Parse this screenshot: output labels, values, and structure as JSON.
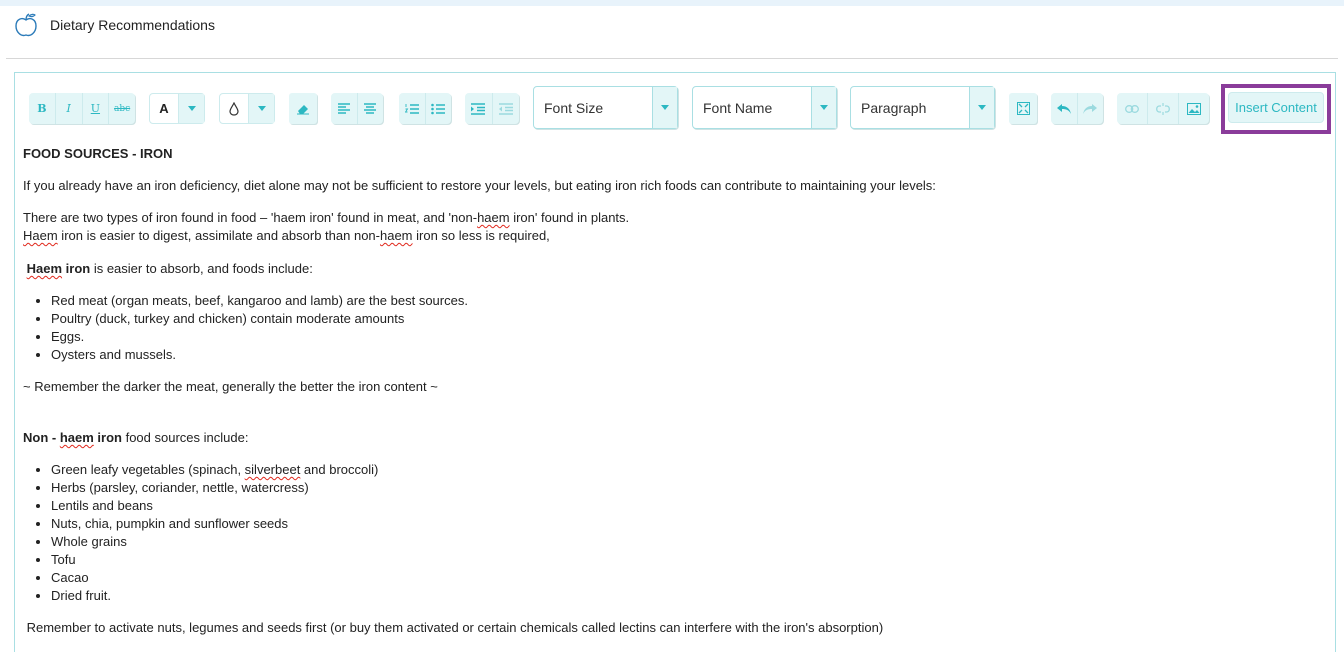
{
  "header": {
    "title": "Dietary Recommendations",
    "icon": "apple-icon"
  },
  "toolbar": {
    "bold_label": "B",
    "italic_label": "I",
    "underline_label": "U",
    "strikethrough_label": "abc",
    "font_color_label": "A",
    "font_size": {
      "value": "Font Size"
    },
    "font_name": {
      "value": "Font Name"
    },
    "format_block": {
      "value": "Paragraph"
    },
    "insert_content_label": "Insert Content",
    "accent_color": "#2cb8c2",
    "highlight_frame_color": "#8a3c9a"
  },
  "content": {
    "heading": "FOOD SOURCES  - IRON",
    "intro": "If you already have an iron deficiency, diet alone may not be sufficient to restore your levels, but eating iron rich foods can contribute to maintaining your levels:",
    "types_line_pre": "There are two types of iron found in food – 'haem iron' found in meat, and 'non-",
    "types_line_haem": "haem",
    "types_line_post": " iron' found in plants.",
    "digest_haem1": "Haem",
    "digest_mid": " iron is easier to digest, assimilate and absorb than non-",
    "digest_haem2": "haem",
    "digest_post": " iron so less is required,",
    "haem_heading_pre": " ",
    "haem_heading_bold1": "Haem",
    "haem_heading_bold2": " iron",
    "haem_heading_rest": " is easier to absorb, and foods include:",
    "haem_items": [
      "Red meat (organ meats, beef, kangaroo and lamb) are the best sources.",
      "Poultry (duck, turkey and chicken) contain moderate amounts",
      "Eggs.",
      "Oysters and mussels."
    ],
    "remember_meat": "~ Remember the darker the meat, generally the better the iron content ~",
    "nonhaem_bold_pre": "Non - ",
    "nonhaem_bold_haem": "haem",
    "nonhaem_bold_post": " iron",
    "nonhaem_rest": " food sources include:",
    "nonhaem_item1_pre": "Green leafy vegetables (spinach, ",
    "nonhaem_item1_word": "silverbeet",
    "nonhaem_item1_post": " and broccoli)",
    "nonhaem_items": [
      "Herbs (parsley, coriander, nettle, watercress)",
      "Lentils and beans",
      "Nuts, chia,  pumpkin and sunflower seeds",
      "Whole grains",
      "Tofu",
      "Cacao",
      "Dried fruit."
    ],
    "activate_note": " Remember to activate nuts, legumes and seeds first (or buy them activated or certain chemicals called lectins can interfere with the iron's absorption)"
  }
}
